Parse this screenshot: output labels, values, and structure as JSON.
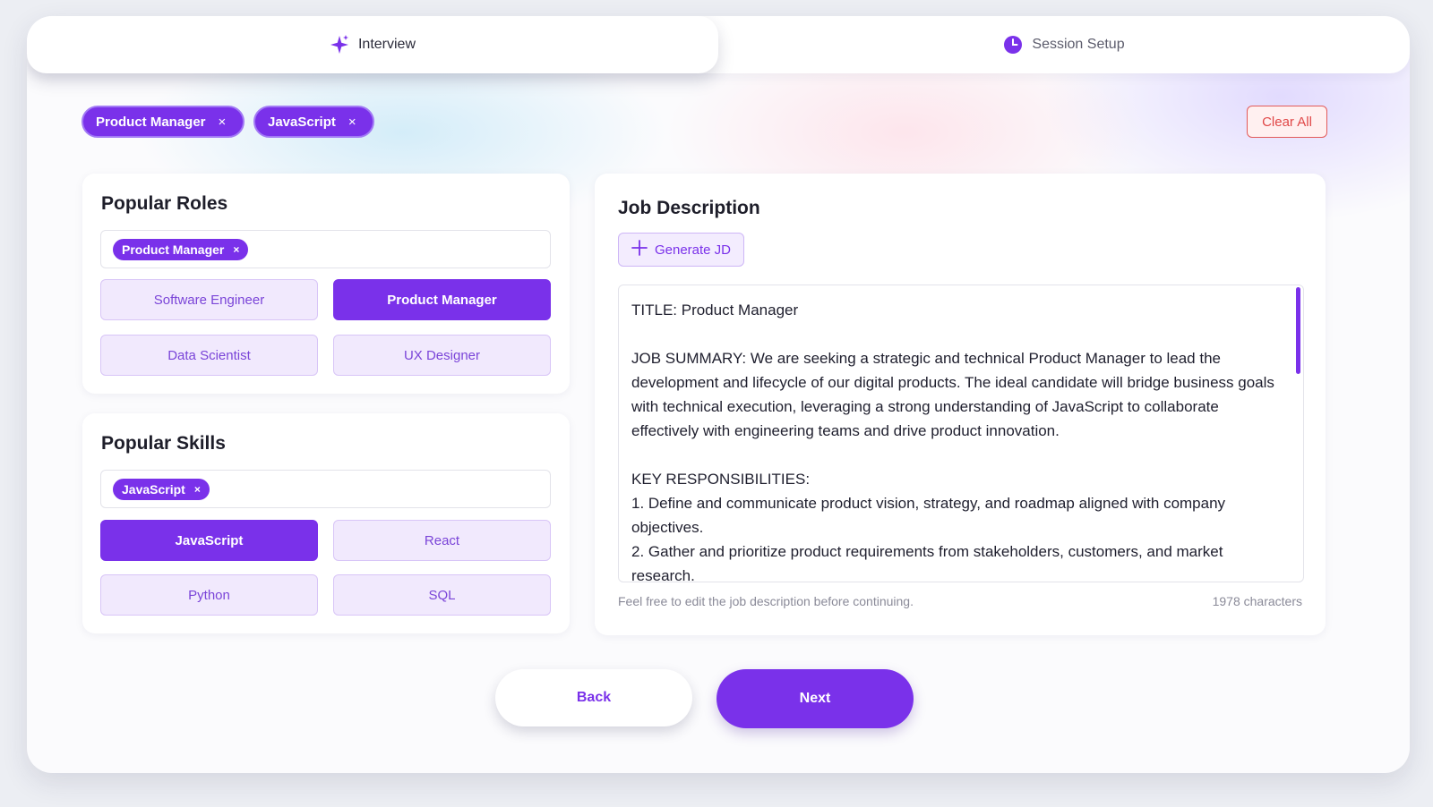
{
  "tabs": {
    "interview_label": "Interview",
    "session_label": "Session Setup"
  },
  "selected_chips": {
    "role": "Product Manager",
    "skill": "JavaScript",
    "remove_glyph": "×"
  },
  "clear_all_label": "Clear All",
  "roles": {
    "title": "Popular Roles",
    "selected": "Product Manager",
    "options": [
      "Software Engineer",
      "Product Manager",
      "Data Scientist",
      "UX Designer"
    ],
    "active": "Product Manager"
  },
  "skills": {
    "title": "Popular Skills",
    "selected": "JavaScript",
    "options": [
      "JavaScript",
      "React",
      "Python",
      "SQL"
    ],
    "active": "JavaScript"
  },
  "job_description": {
    "title": "Job Description",
    "generate_label": "Generate JD",
    "text": "TITLE: Product Manager\n\nJOB SUMMARY: We are seeking a strategic and technical Product Manager to lead the development and lifecycle of our digital products. The ideal candidate will bridge business goals with technical execution, leveraging a strong understanding of JavaScript to collaborate effectively with engineering teams and drive product innovation.\n\nKEY RESPONSIBILITIES:\n1. Define and communicate product vision, strategy, and roadmap aligned with company objectives.\n2. Gather and prioritize product requirements from stakeholders, customers, and market research.",
    "hint": "Feel free to edit the job description before continuing.",
    "char_count": "1978 characters"
  },
  "nav": {
    "back_label": "Back",
    "next_label": "Next"
  },
  "colors": {
    "accent": "#7a31ea",
    "accent_light": "#f1e9fd",
    "danger": "#e04848"
  },
  "icons": {
    "interview": "sparkle-icon",
    "session": "clock-icon",
    "generate": "plus-icon",
    "remove": "close-icon"
  }
}
